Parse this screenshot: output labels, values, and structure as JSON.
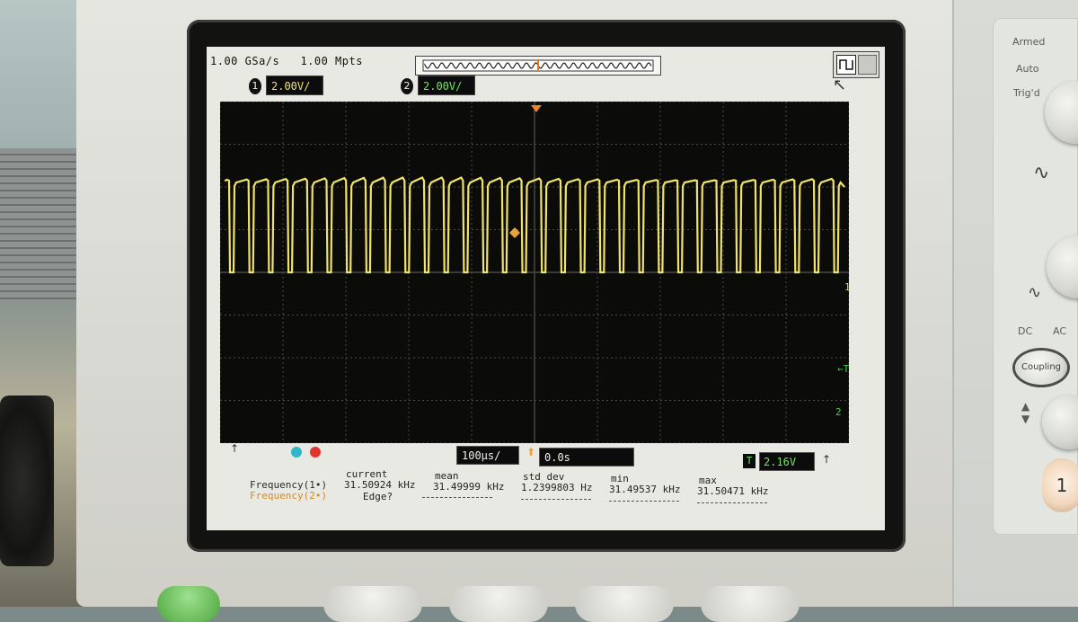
{
  "scope": {
    "sample_rate": "1.00 GSa/s",
    "memory_depth": "1.00 Mpts",
    "channel1": {
      "number": "1",
      "scale": "2.00V/"
    },
    "channel2": {
      "number": "2",
      "scale": "2.00V/"
    },
    "timebase": "100µs/",
    "delay": "0.0s",
    "trigger": {
      "symbol": "T",
      "level": "2.16V"
    },
    "markers": {
      "ch1_ref": "1",
      "trig": "T",
      "ch2_ref": "2"
    }
  },
  "measurements": {
    "headers": {
      "current": "current",
      "mean": "mean",
      "std_dev": "std dev",
      "min": "min",
      "max": "max"
    },
    "rows": [
      {
        "label": "Frequency(1•)",
        "current": "31.50924 kHz",
        "mean": "31.49999 kHz",
        "std_dev": "1.2399803 Hz",
        "min": "31.49537 kHz",
        "max": "31.50471 kHz",
        "color": "#2a2a2a"
      },
      {
        "label": "Frequency(2•)",
        "current": "Edge?",
        "color": "#d9891f"
      }
    ]
  },
  "panel": {
    "armed": "Armed",
    "auto": "Auto",
    "trigd": "Trig'd",
    "dc": "DC",
    "ac": "AC",
    "coupling": "Coupling",
    "channel_number": "1"
  },
  "colors": {
    "ch1": "#f0e36a",
    "ch2": "#6fe85e",
    "grid": "#4a4a46"
  }
}
